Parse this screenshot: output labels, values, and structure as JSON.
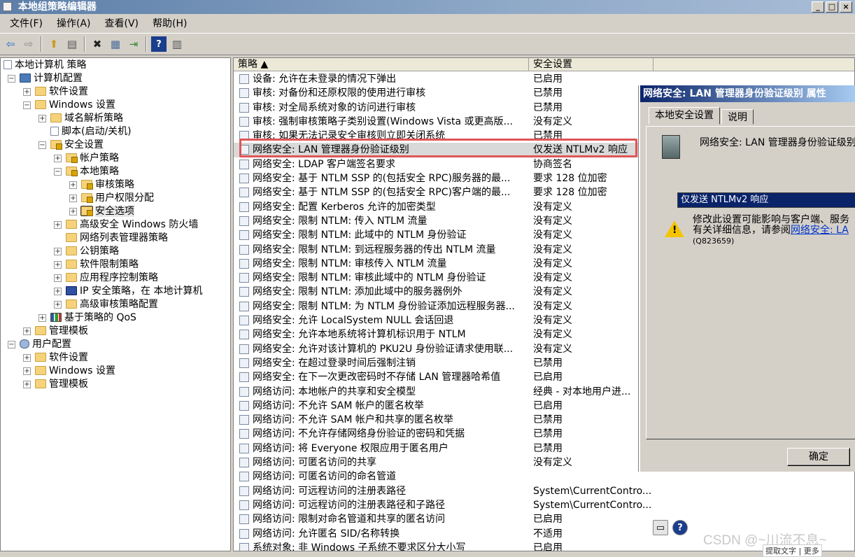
{
  "window": {
    "title": "本地组策略编辑器",
    "btn_min": "_",
    "btn_max": "□",
    "btn_close": "×"
  },
  "menu": [
    "文件(F)",
    "操作(A)",
    "查看(V)",
    "帮助(H)"
  ],
  "toolbar": {
    "back": "⇦",
    "forward": "⇨",
    "up": "⬆",
    "show": "▤",
    "delete": "✖",
    "props": "▦",
    "export": "⇥",
    "help": "?",
    "view": "▥"
  },
  "tree": [
    {
      "label": "本地计算机 策略",
      "icon": "doc-icon",
      "expander": ""
    },
    {
      "label": "计算机配置",
      "icon": "computer-icon",
      "expander": "−"
    },
    {
      "label": "软件设置",
      "icon": "folder-icon",
      "expander": "+"
    },
    {
      "label": "Windows 设置",
      "icon": "folder-icon",
      "expander": "−"
    },
    {
      "label": "域名解析策略",
      "icon": "folder-icon",
      "expander": "+"
    },
    {
      "label": "脚本(启动/关机)",
      "icon": "script-icon",
      "expander": ""
    },
    {
      "label": "安全设置",
      "icon": "security-folder-icon",
      "expander": "−"
    },
    {
      "label": "帐户策略",
      "icon": "security-folder-icon",
      "expander": "+"
    },
    {
      "label": "本地策略",
      "icon": "security-folder-icon",
      "expander": "−"
    },
    {
      "label": "审核策略",
      "icon": "security-folder-icon",
      "expander": "+"
    },
    {
      "label": "用户权限分配",
      "icon": "security-folder-icon",
      "expander": "+"
    },
    {
      "label": "安全选项",
      "icon": "security-folder-icon",
      "expander": "+"
    },
    {
      "label": "高级安全 Windows 防火墙",
      "icon": "folder-icon",
      "expander": "+"
    },
    {
      "label": "网络列表管理器策略",
      "icon": "folder-icon",
      "expander": ""
    },
    {
      "label": "公钥策略",
      "icon": "folder-icon",
      "expander": "+"
    },
    {
      "label": "软件限制策略",
      "icon": "folder-icon",
      "expander": "+"
    },
    {
      "label": "应用程序控制策略",
      "icon": "folder-icon",
      "expander": "+"
    },
    {
      "label": "IP 安全策略，在 本地计算机",
      "icon": "ip-security-icon",
      "expander": "+"
    },
    {
      "label": "高级审核策略配置",
      "icon": "folder-icon",
      "expander": "+"
    },
    {
      "label": "基于策略的 QoS",
      "icon": "qos-chart-icon",
      "expander": "+"
    },
    {
      "label": "管理模板",
      "icon": "folder-icon",
      "expander": "+"
    },
    {
      "label": "用户配置",
      "icon": "user-icon",
      "expander": "−"
    },
    {
      "label": "软件设置",
      "icon": "folder-icon",
      "expander": "+"
    },
    {
      "label": "Windows 设置",
      "icon": "folder-icon",
      "expander": "+"
    },
    {
      "label": "管理模板",
      "icon": "folder-icon",
      "expander": "+"
    }
  ],
  "list": {
    "col_policy": "策略  ▲",
    "col_setting": "安全设置",
    "rows": [
      {
        "policy": "设备: 允许在未登录的情况下弹出",
        "setting": "已启用"
      },
      {
        "policy": "审核: 对备份和还原权限的使用进行审核",
        "setting": "已禁用"
      },
      {
        "policy": "审核: 对全局系统对象的访问进行审核",
        "setting": "已禁用"
      },
      {
        "policy": "审核: 强制审核策略子类别设置(Windows Vista 或更高版...",
        "setting": "没有定义"
      },
      {
        "policy": "审核: 如果无法记录安全审核则立即关闭系统",
        "setting": "已禁用"
      },
      {
        "policy": "网络安全: LAN 管理器身份验证级别",
        "setting": "仅发送 NTLMv2 响应"
      },
      {
        "policy": "网络安全: LDAP 客户端签名要求",
        "setting": "协商签名"
      },
      {
        "policy": "网络安全: 基于 NTLM SSP 的(包括安全 RPC)服务器的最...",
        "setting": "要求 128 位加密"
      },
      {
        "policy": "网络安全: 基于 NTLM SSP 的(包括安全 RPC)客户端的最...",
        "setting": "要求 128 位加密"
      },
      {
        "policy": "网络安全: 配置 Kerberos 允许的加密类型",
        "setting": "没有定义"
      },
      {
        "policy": "网络安全: 限制 NTLM: 传入 NTLM 流量",
        "setting": "没有定义"
      },
      {
        "policy": "网络安全: 限制 NTLM: 此域中的 NTLM 身份验证",
        "setting": "没有定义"
      },
      {
        "policy": "网络安全: 限制 NTLM: 到远程服务器的传出 NTLM 流量",
        "setting": "没有定义"
      },
      {
        "policy": "网络安全: 限制 NTLM: 审核传入 NTLM 流量",
        "setting": "没有定义"
      },
      {
        "policy": "网络安全: 限制 NTLM: 审核此域中的 NTLM 身份验证",
        "setting": "没有定义"
      },
      {
        "policy": "网络安全: 限制 NTLM: 添加此域中的服务器例外",
        "setting": "没有定义"
      },
      {
        "policy": "网络安全: 限制 NTLM: 为 NTLM 身份验证添加远程服务器...",
        "setting": "没有定义"
      },
      {
        "policy": "网络安全: 允许 LocalSystem NULL 会话回退",
        "setting": "没有定义"
      },
      {
        "policy": "网络安全: 允许本地系统将计算机标识用于 NTLM",
        "setting": "没有定义"
      },
      {
        "policy": "网络安全: 允许对该计算机的 PKU2U 身份验证请求使用联...",
        "setting": "没有定义"
      },
      {
        "policy": "网络安全: 在超过登录时间后强制注销",
        "setting": "已禁用"
      },
      {
        "policy": "网络安全: 在下一次更改密码时不存储 LAN 管理器哈希值",
        "setting": "已启用"
      },
      {
        "policy": "网络访问: 本地帐户的共享和安全模型",
        "setting": "经典 - 对本地用户进..."
      },
      {
        "policy": "网络访问: 不允许 SAM 帐户的匿名枚举",
        "setting": "已启用"
      },
      {
        "policy": "网络访问: 不允许 SAM 帐户和共享的匿名枚举",
        "setting": "已禁用"
      },
      {
        "policy": "网络访问: 不允许存储网络身份验证的密码和凭据",
        "setting": "已禁用"
      },
      {
        "policy": "网络访问: 将 Everyone 权限应用于匿名用户",
        "setting": "已禁用"
      },
      {
        "policy": "网络访问: 可匿名访问的共享",
        "setting": "没有定义"
      },
      {
        "policy": "网络访问: 可匿名访问的命名管道",
        "setting": ""
      },
      {
        "policy": "网络访问: 可远程访问的注册表路径",
        "setting": "System\\CurrentContro..."
      },
      {
        "policy": "网络访问: 可远程访问的注册表路径和子路径",
        "setting": "System\\CurrentContro..."
      },
      {
        "policy": "网络访问: 限制对命名管道和共享的匿名访问",
        "setting": "已启用"
      },
      {
        "policy": "网络访问: 允许匿名 SID/名称转换",
        "setting": "不适用"
      },
      {
        "policy": "系统对象: 非 Windows 子系统不要求区分大小写",
        "setting": "已启用"
      }
    ]
  },
  "dialog": {
    "title": "网络安全: LAN 管理器身份验证级别 属性",
    "tab_local": "本地安全设置",
    "tab_explain": "说明",
    "policy_name": "网络安全: LAN 管理器身份验证级别",
    "selected_value": "仅发送 NTLMv2 响应",
    "warning_line1": "修改此设置可能影响与客户端、服务",
    "warning_line2": "有关详细信息，请参阅",
    "warning_link": "网络安全: LA",
    "warning_line3": "(Q823659)",
    "ok": "确定"
  },
  "watermark": "CSDN @~川流不息~",
  "footer_hint": "提取文字 | 更多"
}
